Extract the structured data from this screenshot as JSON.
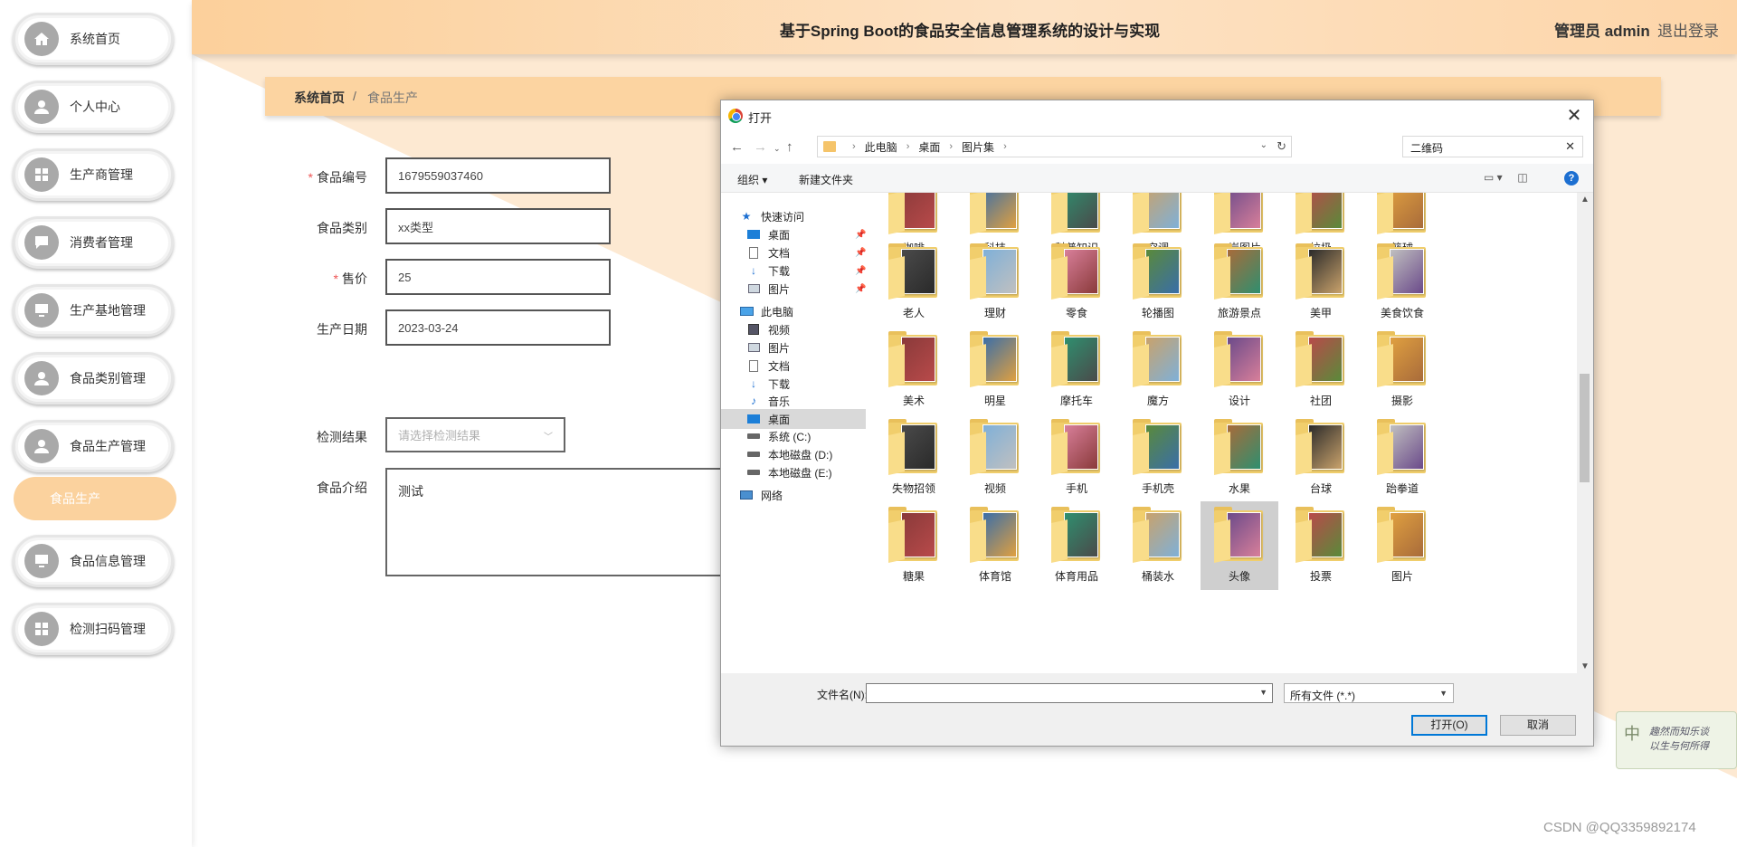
{
  "app": {
    "title": "基于Spring Boot的食品安全信息管理系统的设计与实现",
    "admin_label": "管理员 admin",
    "logout_label": "退出登录"
  },
  "sidebar": {
    "items": [
      {
        "label": "系统首页",
        "icon": "home-icon"
      },
      {
        "label": "个人中心",
        "icon": "user-icon"
      },
      {
        "label": "生产商管理",
        "icon": "grid-icon"
      },
      {
        "label": "消费者管理",
        "icon": "chat-icon"
      },
      {
        "label": "生产基地管理",
        "icon": "monitor-icon"
      },
      {
        "label": "食品类别管理",
        "icon": "user-icon"
      },
      {
        "label": "食品生产管理",
        "icon": "user-icon"
      },
      {
        "label": "食品信息管理",
        "icon": "monitor-icon"
      },
      {
        "label": "检测扫码管理",
        "icon": "grid-icon"
      }
    ],
    "sub_item": "食品生产"
  },
  "breadcrumb": {
    "home": "系统首页",
    "separator": "/",
    "current": "食品生产"
  },
  "form": {
    "food_code": {
      "label": "食品编号",
      "value": "1679559037460",
      "required": true
    },
    "food_category": {
      "label": "食品类别",
      "value": "xx类型"
    },
    "price": {
      "label": "售价",
      "value": "25",
      "required": true
    },
    "production_date": {
      "label": "生产日期",
      "value": "2023-03-24"
    },
    "test_result": {
      "label": "检测结果",
      "placeholder": "请选择检测结果"
    },
    "intro": {
      "label": "食品介绍",
      "value": "测试"
    }
  },
  "dialog": {
    "title": "打开",
    "path": [
      "此电脑",
      "桌面",
      "图片集"
    ],
    "search_text": "二维码",
    "toolbar": {
      "organize": "组织 ▾",
      "new_folder": "新建文件夹",
      "help": "?"
    },
    "nav": [
      {
        "label": "快速访问",
        "icon": "star-icon"
      },
      {
        "label": "桌面",
        "icon": "desktop-icon",
        "pinned": true
      },
      {
        "label": "文档",
        "icon": "document-icon",
        "pinned": true
      },
      {
        "label": "下载",
        "icon": "download-icon",
        "pinned": true
      },
      {
        "label": "图片",
        "icon": "picture-icon",
        "pinned": true
      },
      {
        "label": "此电脑",
        "icon": "computer-icon"
      },
      {
        "label": "视频",
        "icon": "video-icon"
      },
      {
        "label": "图片",
        "icon": "picture-icon"
      },
      {
        "label": "文档",
        "icon": "document-icon"
      },
      {
        "label": "下载",
        "icon": "download-icon"
      },
      {
        "label": "音乐",
        "icon": "music-icon"
      },
      {
        "label": "桌面",
        "icon": "desktop-icon",
        "selected": true
      },
      {
        "label": "系统 (C:)",
        "icon": "drive-icon"
      },
      {
        "label": "本地磁盘 (D:)",
        "icon": "drive-icon"
      },
      {
        "label": "本地磁盘 (E:)",
        "icon": "drive-icon"
      },
      {
        "label": "网络",
        "icon": "network-icon"
      }
    ],
    "folders": [
      [
        "咖啡",
        "科技",
        "科普知识",
        "空调",
        "口岸图片",
        "垃圾",
        "篮球"
      ],
      [
        "老人",
        "理财",
        "零食",
        "轮播图",
        "旅游景点",
        "美甲",
        "美食饮食"
      ],
      [
        "美术",
        "明星",
        "摩托车",
        "魔方",
        "设计",
        "社团",
        "摄影"
      ],
      [
        "失物招领",
        "视频",
        "手机",
        "手机壳",
        "水果",
        "台球",
        "跆拳道"
      ],
      [
        "糖果",
        "体育馆",
        "体育用品",
        "桶装水",
        "头像",
        "投票",
        "图片"
      ]
    ],
    "selected_folder": "头像",
    "filename_label": "文件名(N):",
    "filetype": "所有文件 (*.*)",
    "open_label": "打开(O)",
    "cancel_label": "取消"
  },
  "ime": {
    "char": "中",
    "text": [
      "趣然而知乐谈",
      "以生与何所得"
    ]
  },
  "watermark": "CSDN @QQ3359892174",
  "colors": {
    "accent": "#fbd29e",
    "topbar": "#fde2c4",
    "icon_gray": "#a9a9a9",
    "folder": "#f1ce6c"
  }
}
